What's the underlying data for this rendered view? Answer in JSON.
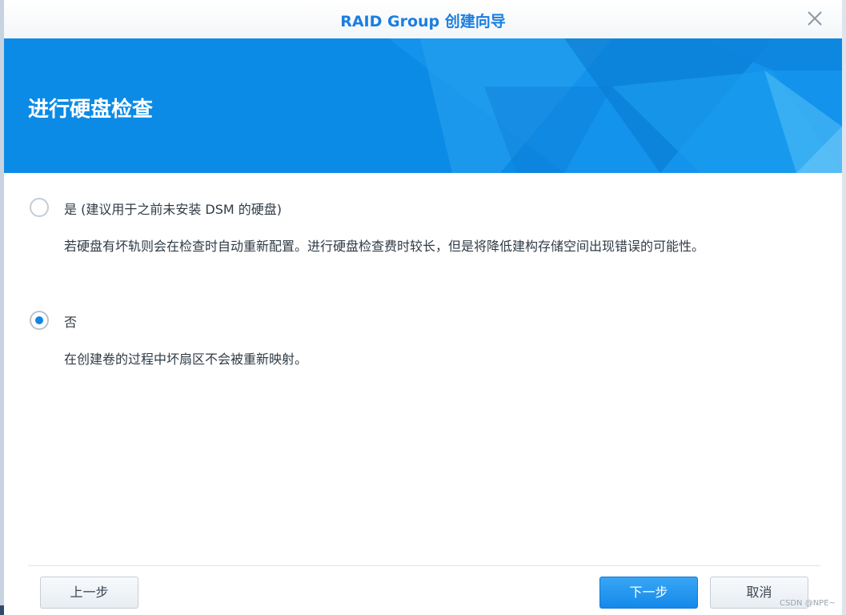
{
  "dialog": {
    "title": "RAID Group 创建向导"
  },
  "banner": {
    "title": "进行硬盘检查"
  },
  "options": [
    {
      "label": "是 (建议用于之前未安装 DSM 的硬盘)",
      "description": "若硬盘有坏轨则会在检查时自动重新配置。进行硬盘检查费时较长，但是将降低建构存储空间出现错误的可能性。",
      "selected": false
    },
    {
      "label": "否",
      "description": "在创建卷的过程中坏扇区不会被重新映射。",
      "selected": true
    }
  ],
  "footer": {
    "back_label": "上一步",
    "next_label": "下一步",
    "cancel_label": "取消"
  },
  "watermark": "CSDN @NPE~",
  "colors": {
    "accent": "#0f86e6",
    "title": "#1b7ee0",
    "banner": "#0b8be6"
  },
  "icons": {
    "close": "close-icon"
  }
}
